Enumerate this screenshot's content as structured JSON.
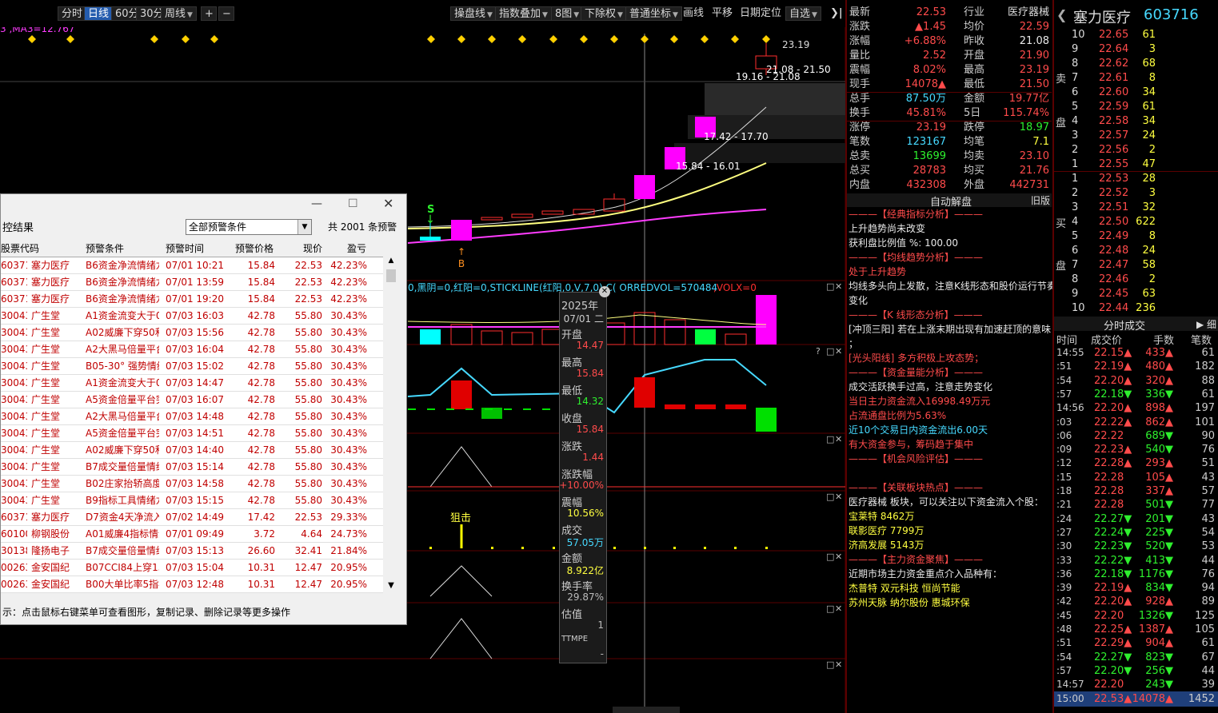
{
  "toolbar": {
    "periods": [
      "分时",
      "日线",
      "60分",
      "30分",
      "周线"
    ],
    "active_period": "日线",
    "plus": "+",
    "minus": "−",
    "menus": [
      "操盘线",
      "指数叠加",
      "8图",
      "下除权",
      "普通坐标"
    ],
    "tools": [
      "画线",
      "平移",
      "日期定位"
    ],
    "self_select": "自选",
    "collapse": "❯|"
  },
  "chart": {
    "ma_label": "3 ,MA3=12.767",
    "annotations": {
      "p1": "23.19",
      "p2": "21.08 - 21.50",
      "p3": "19.16 - 21.08",
      "p4": "17.42 - 17.70",
      "p5": "15.84 - 16.01",
      "s_mark": "S",
      "b_mark": "B",
      "snipe": "狙击"
    },
    "vol_indicator": "0,黑阴=0,红阳=0,STICKLINE(红阳,0,V,7,0),C( ORREDVOL=570484",
    "volx": ",VOLX=0",
    "colors": {
      "up": "#ff2e2e",
      "down": "#00ffff",
      "limit": "#ff00ff",
      "ma1": "#ffff80",
      "ma2": "#ff3cff",
      "ma3": "#dddddd"
    }
  },
  "tooltip": {
    "year": "2025年",
    "date": "07/01 二",
    "open_label": "开盘",
    "open": "14.47",
    "high_label": "最高",
    "high": "15.84",
    "low_label": "最低",
    "low": "14.32",
    "close_label": "收盘",
    "close": "15.84",
    "chg_label": "涨跌",
    "chg": "1.44",
    "pct_label": "涨跌幅",
    "pct": "+10.00%",
    "amp_label": "震幅",
    "amp": "10.56%",
    "vol_label": "成交",
    "vol": "57.05万",
    "amt_label": "金额",
    "amt": "8.922亿",
    "turn_label": "换手率",
    "turn": "29.87%",
    "val_label": "估值",
    "val": "1",
    "ttmpe": "TTMPE",
    "ttmpe_val": "-"
  },
  "dialog": {
    "title": "控结果",
    "condition": "全部预警条件",
    "total": "共 2001 条预警",
    "headers": [
      "股票代码",
      "预警条件",
      "预警时间",
      "预警价格",
      "现价",
      "盈亏"
    ],
    "rows": [
      [
        "603716",
        "塞力医疗",
        "B6资金净流情绪龙",
        "07/01 10:21",
        "15.84",
        "22.53",
        "42.23%"
      ],
      [
        "603716",
        "塞力医疗",
        "B6资金净流情绪龙",
        "07/01 13:59",
        "15.84",
        "22.53",
        "42.23%"
      ],
      [
        "603716",
        "塞力医疗",
        "B6资金净流情绪龙",
        "07/01 19:20",
        "15.84",
        "22.53",
        "42.23%"
      ],
      [
        "300436",
        "广生堂",
        "A1资金流变大于0.",
        "07/03 16:03",
        "42.78",
        "55.80",
        "30.43%"
      ],
      [
        "300436",
        "广生堂",
        "A02威廉下穿50和2",
        "07/03 15:56",
        "42.78",
        "55.80",
        "30.43%"
      ],
      [
        "300436",
        "广生堂",
        "A2大黑马倍量平台",
        "07/03 16:04",
        "42.78",
        "55.80",
        "30.43%"
      ],
      [
        "300436",
        "广生堂",
        "B05-30° 强势情绪",
        "07/03 15:02",
        "42.78",
        "55.80",
        "30.43%"
      ],
      [
        "300436",
        "广生堂",
        "A1资金流变大于0.",
        "07/03 14:47",
        "42.78",
        "55.80",
        "30.43%"
      ],
      [
        "300436",
        "广生堂",
        "A5资金倍量平台突",
        "07/03 16:07",
        "42.78",
        "55.80",
        "30.43%"
      ],
      [
        "300436",
        "广生堂",
        "A2大黑马倍量平台",
        "07/03 14:48",
        "42.78",
        "55.80",
        "30.43%"
      ],
      [
        "300436",
        "广生堂",
        "A5资金倍量平台突",
        "07/03 14:51",
        "42.78",
        "55.80",
        "30.43%"
      ],
      [
        "300436",
        "广生堂",
        "A02威廉下穿50和2",
        "07/03 14:40",
        "42.78",
        "55.80",
        "30.43%"
      ],
      [
        "300436",
        "广生堂",
        "B7成交量倍量情绪",
        "07/03 15:14",
        "42.78",
        "55.80",
        "30.43%"
      ],
      [
        "300436",
        "广生堂",
        "B02庄家抬轿高度i",
        "07/03 14:58",
        "42.78",
        "55.80",
        "30.43%"
      ],
      [
        "300436",
        "广生堂",
        "B9指标工具情绪龙",
        "07/03 15:15",
        "42.78",
        "55.80",
        "30.43%"
      ],
      [
        "603716",
        "塞力医疗",
        "D7资金4天净流入",
        "07/02 14:49",
        "17.42",
        "22.53",
        "29.33%"
      ],
      [
        "601003",
        "柳钢股份",
        "A01威廉4指标情绪",
        "07/01 09:49",
        "3.72",
        "4.64",
        "24.73%"
      ],
      [
        "301389",
        "隆扬电子",
        "B7成交量倍量情绪",
        "07/03 15:13",
        "26.60",
        "32.41",
        "21.84%"
      ],
      [
        "002636",
        "金安国纪",
        "B07CCI84上穿150",
        "07/03 15:04",
        "10.31",
        "12.47",
        "20.95%"
      ],
      [
        "002636",
        "金安国纪",
        "B00大单比率5指标",
        "07/03 12:48",
        "10.31",
        "12.47",
        "20.95%"
      ]
    ],
    "hint": "示：点击鼠标右键菜单可查看图形，复制记录、删除记录等更多操作"
  },
  "quote": {
    "rows": [
      [
        "最新",
        "22.53",
        "行业",
        "医疗器械"
      ],
      [
        "涨跌",
        "▲1.45",
        "均价",
        "22.59"
      ],
      [
        "涨幅",
        "+6.88%",
        "昨收",
        "21.08"
      ],
      [
        "量比",
        "2.52",
        "开盘",
        "21.90"
      ],
      [
        "震幅",
        "8.02%",
        "最高",
        "23.19"
      ],
      [
        "现手",
        "14078▲",
        "最低",
        "21.50"
      ],
      [
        "总手",
        "87.50万",
        "金额",
        "19.77亿"
      ],
      [
        "换手",
        "45.81%",
        "5日",
        "115.74%"
      ],
      [
        "涨停",
        "23.19",
        "跌停",
        "18.97"
      ],
      [
        "笔数",
        "123167",
        "均笔",
        "7.1"
      ],
      [
        "总卖",
        "13699",
        "均卖",
        "23.10"
      ],
      [
        "总买",
        "28783",
        "均买",
        "21.76"
      ],
      [
        "内盘",
        "432308",
        "外盘",
        "442731"
      ]
    ],
    "auto_label": "自动解盘",
    "old_label": "旧版"
  },
  "analysis": {
    "lines": [
      {
        "t": "———【经典指标分析】———",
        "c": "red"
      },
      {
        "t": "上升趋势尚未改变",
        "c": "wht"
      },
      {
        "t": "获利盘比例值 %: 100.00",
        "c": "wht"
      },
      {
        "t": "———【均线趋势分析】———",
        "c": "red"
      },
      {
        "t": "处于上升趋势",
        "c": "red"
      },
      {
        "t": "均线多头向上发散，注意K线形态和股价运行节奏",
        "c": "wht"
      },
      {
        "t": "变化",
        "c": "wht"
      },
      {
        "t": "———【K 线形态分析】———",
        "c": "red"
      },
      {
        "t": "[冲顶三阳] 若在上涨末期出现有加速赶顶的意味",
        "c": "wht"
      },
      {
        "t": "；",
        "c": "wht"
      },
      {
        "t": "[光头阳线] 多方积极上攻态势；",
        "c": "red"
      },
      {
        "t": "———【资金量能分析】———",
        "c": "red"
      },
      {
        "t": "成交活跃换手过高，注意走势变化",
        "c": "wht"
      },
      {
        "t": "当日主力资金流入16998.49万元",
        "c": "red"
      },
      {
        "t": "占流通盘比例为5.63%",
        "c": "red"
      },
      {
        "t": "近10个交易日内资金流出6.00天",
        "c": "cyan"
      },
      {
        "t": "有大资金参与，筹码趋于集中",
        "c": "red"
      },
      {
        "t": "———【机会风险评估】———",
        "c": "red"
      },
      {
        "t": "",
        "c": "wht"
      },
      {
        "t": "———【关联板块热点】———",
        "c": "red"
      },
      {
        "t": "医疗器械 板块，可以关注以下资金流入个股：",
        "c": "wht"
      },
      {
        "t": "宝莱特 8462万",
        "c": "yel"
      },
      {
        "t": "联影医疗 7799万",
        "c": "yel"
      },
      {
        "t": "济高发展 5143万",
        "c": "yel"
      },
      {
        "t": "———【主力资金聚焦】———",
        "c": "red"
      },
      {
        "t": "近期市场主力资金重点介入品种有：",
        "c": "wht"
      },
      {
        "t": "杰普特 双元科技 恒尚节能",
        "c": "yel"
      },
      {
        "t": "苏州天脉 纳尔股份 惠城环保",
        "c": "yel"
      }
    ]
  },
  "stock": {
    "name": "塞力医疗",
    "code": "603716"
  },
  "orderbook": {
    "sell_label": [
      "卖",
      "盘"
    ],
    "buy_label": [
      "买",
      "盘"
    ],
    "sells": [
      [
        "10",
        "22.65",
        "61"
      ],
      [
        "9",
        "22.64",
        "3"
      ],
      [
        "8",
        "22.62",
        "68"
      ],
      [
        "7",
        "22.61",
        "8"
      ],
      [
        "6",
        "22.60",
        "34"
      ],
      [
        "5",
        "22.59",
        "61"
      ],
      [
        "4",
        "22.58",
        "34"
      ],
      [
        "3",
        "22.57",
        "24"
      ],
      [
        "2",
        "22.56",
        "2"
      ],
      [
        "1",
        "22.55",
        "47"
      ]
    ],
    "buys": [
      [
        "1",
        "22.53",
        "28"
      ],
      [
        "2",
        "22.52",
        "3"
      ],
      [
        "3",
        "22.51",
        "32"
      ],
      [
        "4",
        "22.50",
        "622"
      ],
      [
        "5",
        "22.49",
        "8"
      ],
      [
        "6",
        "22.48",
        "24"
      ],
      [
        "7",
        "22.47",
        "58"
      ],
      [
        "8",
        "22.46",
        "2"
      ],
      [
        "9",
        "22.45",
        "63"
      ],
      [
        "10",
        "22.44",
        "236"
      ]
    ]
  },
  "trades": {
    "title": "分时成交",
    "expand": "▶ 细",
    "headers": [
      "时间",
      "成交价",
      "手数",
      "笔数"
    ],
    "rows": [
      [
        "14:55",
        "22.15▲",
        "433▲",
        "61",
        "red"
      ],
      [
        ":51",
        "22.19▲",
        "480▲",
        "182",
        "red"
      ],
      [
        ":54",
        "22.20▲",
        "320▲",
        "88",
        "red"
      ],
      [
        ":57",
        "22.18▼",
        "336▼",
        "61",
        "grn"
      ],
      [
        "14:56",
        "22.20▲",
        "898▲",
        "197",
        "red"
      ],
      [
        ":03",
        "22.22▲",
        "862▲",
        "101",
        "red"
      ],
      [
        ":06",
        "22.22",
        "689▼",
        "90",
        "grn"
      ],
      [
        ":09",
        "22.23▲",
        "540▼",
        "76",
        "grn"
      ],
      [
        ":12",
        "22.28▲",
        "293▲",
        "51",
        "red"
      ],
      [
        ":15",
        "22.28",
        "105▲",
        "43",
        "red"
      ],
      [
        ":18",
        "22.28",
        "337▲",
        "57",
        "red"
      ],
      [
        ":21",
        "22.28",
        "501▼",
        "77",
        "grn"
      ],
      [
        ":24",
        "22.27▼",
        "201▼",
        "43",
        "grn"
      ],
      [
        ":27",
        "22.24▼",
        "225▼",
        "54",
        "grn"
      ],
      [
        ":30",
        "22.23▼",
        "520▼",
        "53",
        "grn"
      ],
      [
        ":33",
        "22.22▼",
        "413▼",
        "44",
        "grn"
      ],
      [
        ":36",
        "22.18▼",
        "1176▼",
        "76",
        "grn"
      ],
      [
        ":39",
        "22.19▲",
        "834▼",
        "94",
        "grn"
      ],
      [
        ":42",
        "22.20▲",
        "928▲",
        "89",
        "red"
      ],
      [
        ":45",
        "22.20",
        "1326▼",
        "125",
        "grn"
      ],
      [
        ":48",
        "22.25▲",
        "1387▲",
        "105",
        "red"
      ],
      [
        ":51",
        "22.29▲",
        "904▲",
        "61",
        "red"
      ],
      [
        ":54",
        "22.27▼",
        "823▼",
        "67",
        "grn"
      ],
      [
        ":57",
        "22.20▼",
        "256▼",
        "44",
        "grn"
      ],
      [
        "14:57",
        "22.20",
        "243▼",
        "39",
        "grn"
      ],
      [
        "15:00",
        "22.53▲",
        "14078▲",
        "1452",
        "red"
      ]
    ]
  }
}
